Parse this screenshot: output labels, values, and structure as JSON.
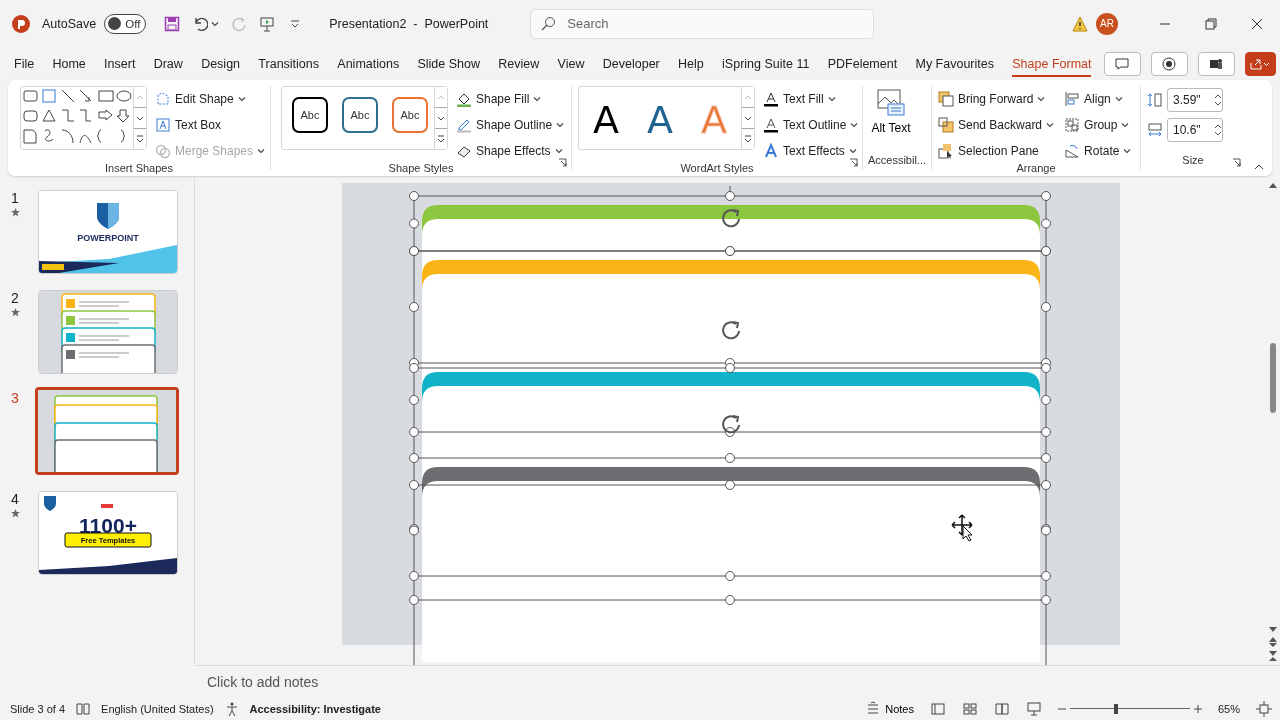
{
  "title_bar": {
    "autosave_label": "AutoSave",
    "autosave": {
      "on": false,
      "label": "Off"
    },
    "document_title": "Presentation2  -  PowerPoint",
    "search": {
      "placeholder": "Search"
    },
    "avatar": "AR"
  },
  "tabs": [
    {
      "label": "File",
      "selected": false
    },
    {
      "label": "Home",
      "selected": false
    },
    {
      "label": "Insert",
      "selected": false
    },
    {
      "label": "Draw",
      "selected": false
    },
    {
      "label": "Design",
      "selected": false
    },
    {
      "label": "Transitions",
      "selected": false
    },
    {
      "label": "Animations",
      "selected": false
    },
    {
      "label": "Slide Show",
      "selected": false
    },
    {
      "label": "Review",
      "selected": false
    },
    {
      "label": "View",
      "selected": false
    },
    {
      "label": "Developer",
      "selected": false
    },
    {
      "label": "Help",
      "selected": false
    },
    {
      "label": "iSpring Suite 11",
      "selected": false
    },
    {
      "label": "PDFelement",
      "selected": false
    },
    {
      "label": "My Favourites",
      "selected": false
    },
    {
      "label": "Shape Format",
      "selected": true
    }
  ],
  "ribbon": {
    "insert_shapes": {
      "label": "Insert Shapes",
      "commands": [
        {
          "label": "Edit Shape",
          "dropdown": true,
          "disabled": false
        },
        {
          "label": "Text Box",
          "dropdown": false,
          "disabled": false
        },
        {
          "label": "Merge Shapes",
          "dropdown": true,
          "disabled": true
        }
      ]
    },
    "shape_styles": {
      "label": "Shape Styles",
      "styles": [
        {
          "label": "Abc",
          "color": "#000000"
        },
        {
          "label": "Abc",
          "color": "#2e6e8e"
        },
        {
          "label": "Abc",
          "color": "#e97132"
        }
      ],
      "commands": [
        {
          "label": "Shape Fill",
          "dropdown": true
        },
        {
          "label": "Shape Outline",
          "dropdown": true
        },
        {
          "label": "Shape Effects",
          "dropdown": true
        }
      ]
    },
    "wordart_styles": {
      "label": "WordArt Styles",
      "styles": [
        {
          "label": "A",
          "kind": "fill",
          "color": "#000000"
        },
        {
          "label": "A",
          "kind": "fill",
          "color": "#1f6391"
        },
        {
          "label": "A",
          "kind": "outline",
          "color": "#e97132"
        }
      ],
      "commands": [
        {
          "label": "Text Fill",
          "dropdown": true
        },
        {
          "label": "Text Outline",
          "dropdown": true
        },
        {
          "label": "Text Effects",
          "dropdown": true
        }
      ]
    },
    "accessibility": {
      "label": "Accessibil...",
      "alt_text": "Alt Text"
    },
    "arrange": {
      "label": "Arrange",
      "commands": [
        {
          "label": "Bring Forward",
          "dropdown": true
        },
        {
          "label": "Align",
          "dropdown": true
        },
        {
          "label": "Send Backward",
          "dropdown": true
        },
        {
          "label": "Group",
          "dropdown": true
        },
        {
          "label": "Selection Pane",
          "dropdown": false
        },
        {
          "label": "Rotate",
          "dropdown": true
        }
      ]
    },
    "size": {
      "label": "Size",
      "height": "3.59\"",
      "width": "10.6\""
    }
  },
  "slides": [
    {
      "number": "1",
      "selected": false,
      "kind": "title",
      "texts": [
        "POWERPOINT"
      ]
    },
    {
      "number": "2",
      "selected": false,
      "kind": "list"
    },
    {
      "number": "3",
      "selected": true,
      "kind": "blank"
    },
    {
      "number": "4",
      "selected": false,
      "kind": "promo",
      "texts": [
        "1100+",
        "Free Templates"
      ]
    }
  ],
  "canvas": {
    "cards": [
      {
        "color": "#8dc63f"
      },
      {
        "color": "#fbb415"
      },
      {
        "color": "#11b3c9"
      },
      {
        "color": "#6d6e71"
      }
    ]
  },
  "notes": {
    "placeholder": "Click to add notes"
  },
  "status_bar": {
    "slide_info": "Slide 3 of 4",
    "language": "English (United States)",
    "accessibility": "Accessibility: Investigate",
    "notes": "Notes",
    "zoom": {
      "level": 0.38,
      "label": "65%"
    }
  }
}
